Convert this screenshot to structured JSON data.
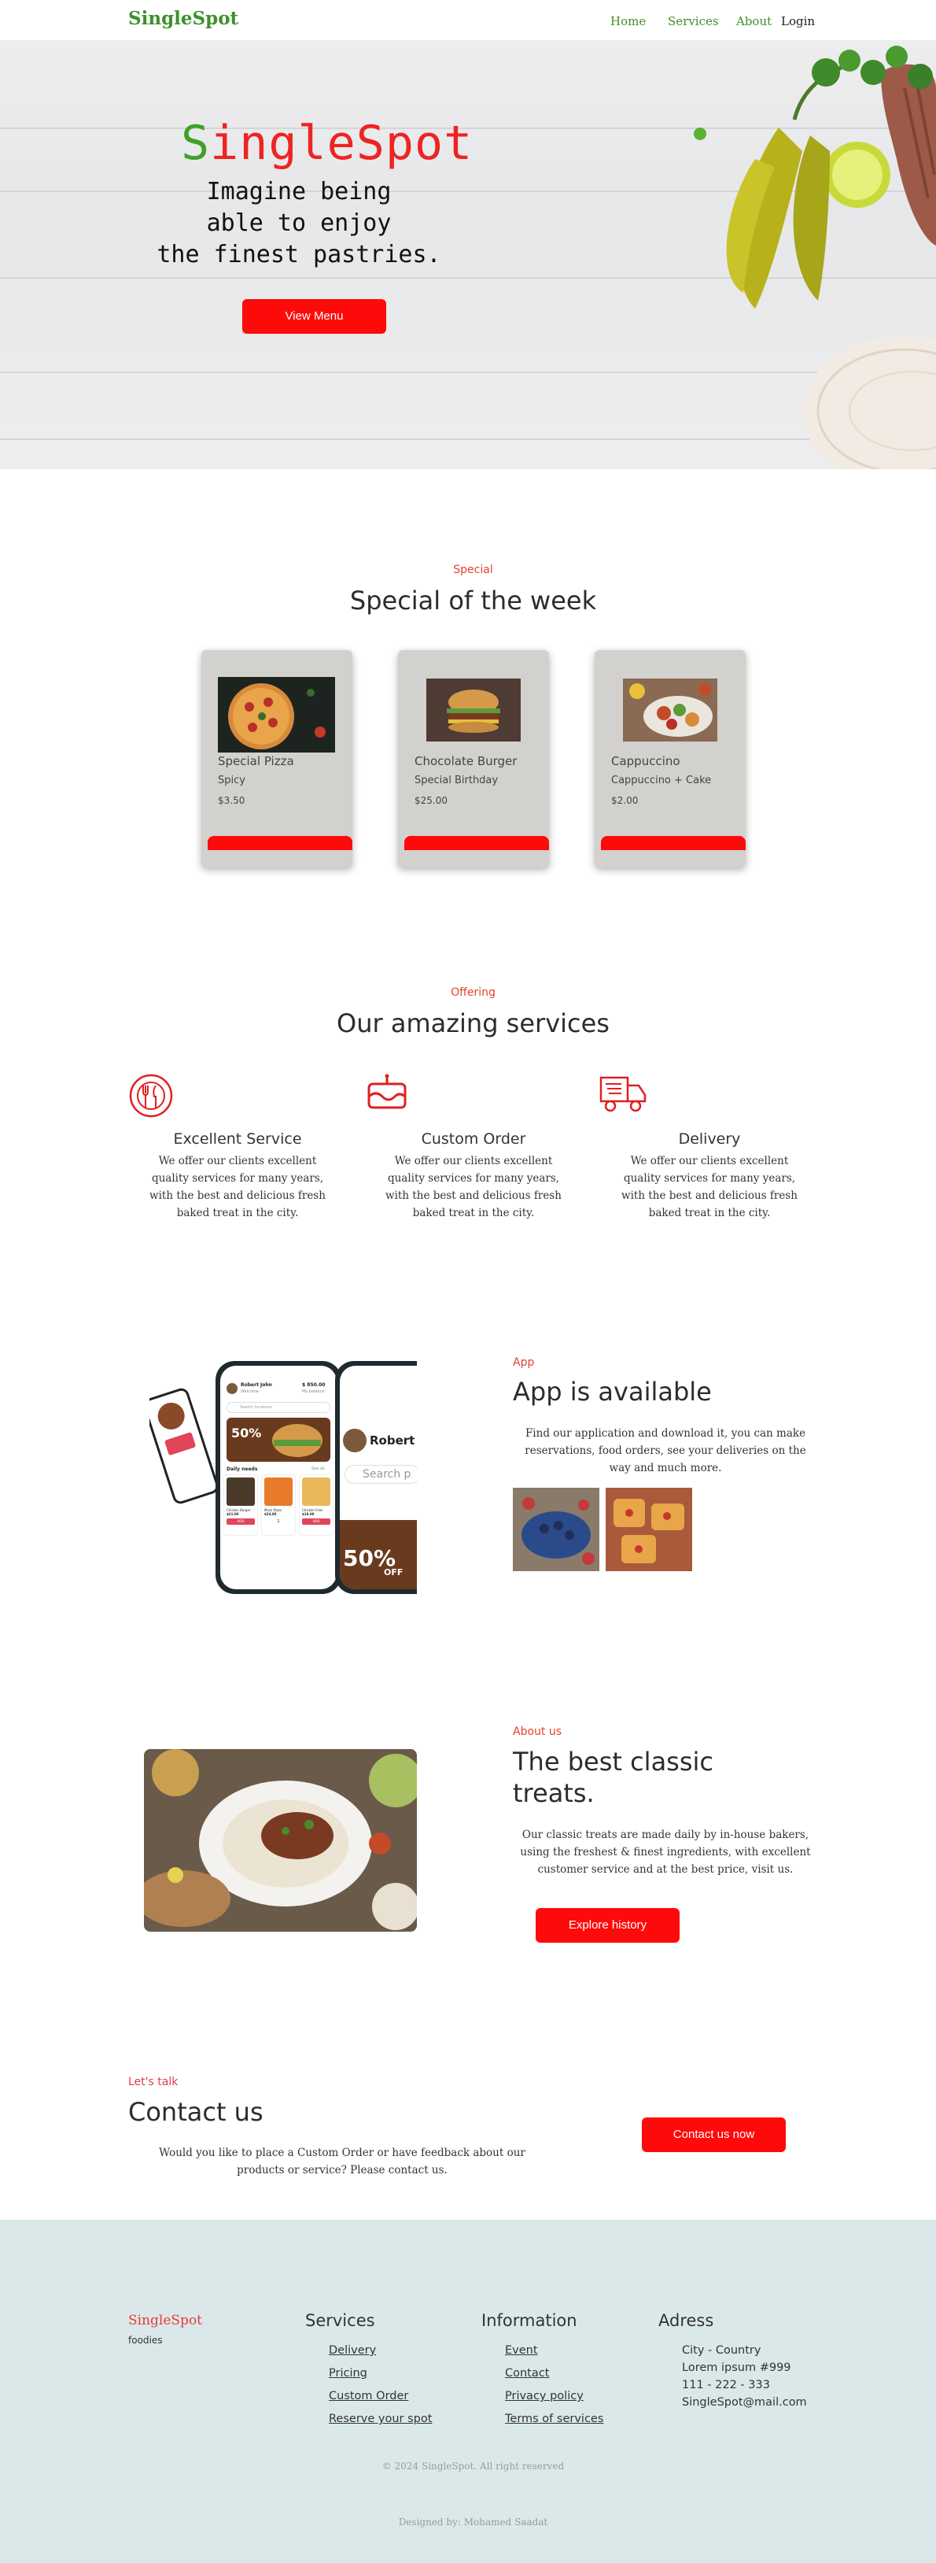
{
  "nav": {
    "brand": "SingleSpot",
    "links": [
      "Home",
      "Services",
      "About"
    ],
    "login": "Login"
  },
  "hero": {
    "title_first": "S",
    "title_rest": "ingleSpot",
    "line1": "Imagine being",
    "line2": "able to enjoy",
    "line3": "the finest pastries.",
    "button": "View Menu"
  },
  "special": {
    "eyebrow": "Special",
    "title": "Special of the week",
    "cards": [
      {
        "name": "Special Pizza",
        "sub": "Spicy",
        "price": "$3.50"
      },
      {
        "name": "Chocolate Burger",
        "sub": "Special Birthday",
        "price": "$25.00"
      },
      {
        "name": "Cappuccino",
        "sub": "Cappuccino + Cake",
        "price": "$2.00"
      }
    ]
  },
  "services": {
    "eyebrow": "Offering",
    "title": "Our amazing services",
    "items": [
      {
        "title": "Excellent Service",
        "icon": "utensils-icon",
        "text": "We offer our clients excellent quality services for many years, with the best and delicious fresh baked treat in the city."
      },
      {
        "title": "Custom Order",
        "icon": "cake-icon",
        "text": "We offer our clients excellent quality services for many years, with the best and delicious fresh baked treat in the city."
      },
      {
        "title": "Delivery",
        "icon": "delivery-truck-icon",
        "text": "We offer our clients excellent quality services for many years, with the best and delicious fresh baked treat in the city."
      }
    ]
  },
  "app": {
    "eyebrow": "App",
    "title": "App is available",
    "text": "Find our application and download it, you can make reservations, food orders, see your deliveries on the way and much more.",
    "phone": {
      "user": "Robert John",
      "greeting": "Welcome",
      "balance": "$ 850.00",
      "balance_label": "My balance",
      "search": "Search locations",
      "promo": "50%",
      "daily": "Daily needs",
      "see_all": "See all",
      "side_name": "Robert",
      "side_search": "Search p",
      "side_promo": "50%",
      "side_off": "OFF",
      "items": [
        {
          "name": "Chicken Burger",
          "price": "$21.00"
        },
        {
          "name": "Mirzs Pizza",
          "price": "$24.00"
        },
        {
          "name": "Chicken Fries",
          "price": "$18.00"
        }
      ],
      "add": "ADD",
      "qty": "1"
    }
  },
  "about": {
    "eyebrow": "About us",
    "title_line1": "The best classic",
    "title_line2": "treats.",
    "text": "Our classic treats are made daily by in-house bakers, using the freshest & finest ingredients, with excellent customer service and at the best price, visit us.",
    "button": "Explore history"
  },
  "contact": {
    "eyebrow": "Let's talk",
    "title": "Contact us",
    "text": "Would you like to place a Custom Order or have feedback about our products or service? Please contact us.",
    "button": "Contact us now"
  },
  "footer": {
    "brand": "SingleSpot",
    "tagline": "foodies",
    "services_title": "Services",
    "services": [
      "Delivery",
      "Pricing",
      "Custom Order",
      "Reserve your spot"
    ],
    "info_title": "Information",
    "info": [
      "Event",
      "Contact",
      "Privacy policy",
      "Terms of services"
    ],
    "address_title": "Adress",
    "address": [
      "City - Country",
      "Lorem ipsum #999",
      "111 - 222 - 333",
      "SingleSpot@mail.com"
    ],
    "copyright": "© 2024 SingleSpot. All right reserved",
    "designed": "Designed by: Mohamed Saadat"
  },
  "colors": {
    "accent_red": "#fe0a0a",
    "brand_green": "#3f8f2b",
    "footer_bg": "#dbe8e9",
    "card_bg": "#d3d1cd"
  }
}
